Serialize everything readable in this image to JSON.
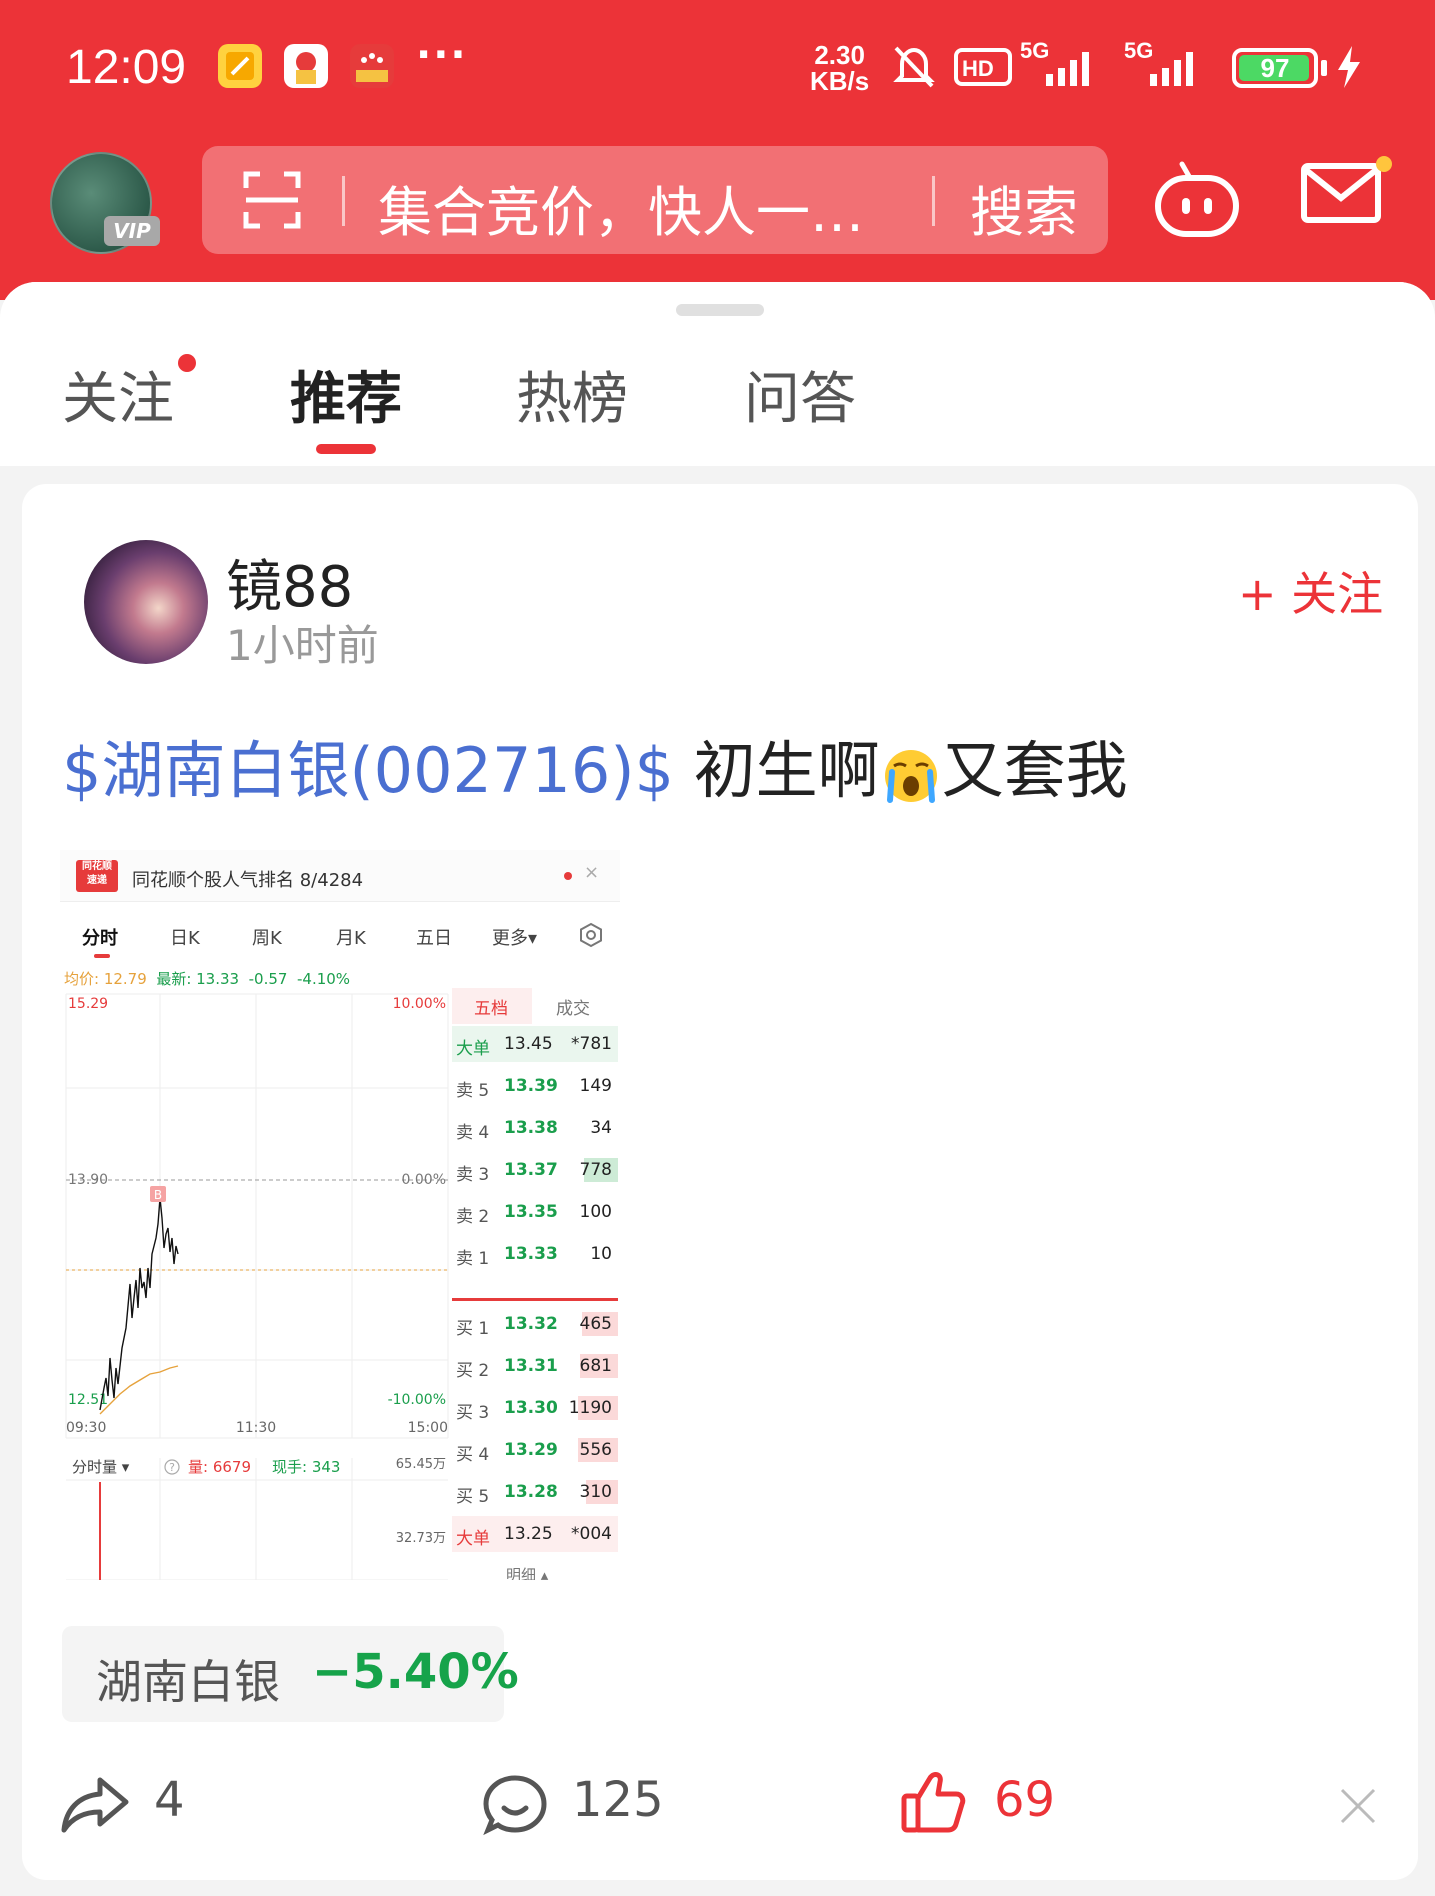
{
  "status_bar": {
    "time": "12:09",
    "net_speed_value": "2.30",
    "net_speed_unit": "KB/s",
    "signal_1": "5G",
    "signal_2": "5G",
    "battery": "97",
    "battery_level_percent": 97
  },
  "header": {
    "search_placeholder": "集合竞价，快人一…",
    "search_button": "搜索",
    "vip_badge": "VIP"
  },
  "tabs": [
    {
      "label": "关注",
      "has_dot": true
    },
    {
      "label": "推荐",
      "active": true
    },
    {
      "label": "热榜"
    },
    {
      "label": "问答"
    }
  ],
  "post": {
    "author": "镜88",
    "time": "1小时前",
    "follow": "+ 关注",
    "stock_link": "$湖南白银(002716)$",
    "text_part1": " 初生啊",
    "text_part2": "又套我",
    "emoji": "crying-face"
  },
  "screenshot": {
    "app_logo": "同花顺速递",
    "title": "同花顺个股人气排名 8/4284",
    "tabs": [
      "分时",
      "日K",
      "周K",
      "月K",
      "五日",
      "更多▾"
    ],
    "info_avg": "均价: 12.79",
    "info_latest": "最新: 13.33",
    "info_change": "-0.57",
    "info_pct": "-4.10%",
    "y_top": "15.29",
    "y_mid": "13.90",
    "y_bot": "12.51",
    "pct_top": "10.00%",
    "pct_mid": "0.00%",
    "pct_bot": "-10.00%",
    "x_start": "09:30",
    "x_mid": "11:30",
    "x_end": "15:00",
    "vol_label": "分时量 ▾",
    "vol_amount": "量: 6679",
    "vol_hand": "现手: 343",
    "vol_top": "65.45万",
    "vol_mid": "32.73万",
    "marker": "B",
    "orderbook_tab_1": "五档",
    "orderbook_tab_2": "成交",
    "orderbook_footer": "明细 ▴",
    "orderbook": [
      {
        "label": "大单",
        "price": "13.45",
        "vol": "*781"
      },
      {
        "label": "卖 5",
        "price": "13.39",
        "vol": "149"
      },
      {
        "label": "卖 4",
        "price": "13.38",
        "vol": "34"
      },
      {
        "label": "卖 3",
        "price": "13.37",
        "vol": "778"
      },
      {
        "label": "卖 2",
        "price": "13.35",
        "vol": "100"
      },
      {
        "label": "卖 1",
        "price": "13.33",
        "vol": "10"
      },
      {
        "label": "买 1",
        "price": "13.32",
        "vol": "465"
      },
      {
        "label": "买 2",
        "price": "13.31",
        "vol": "681"
      },
      {
        "label": "买 3",
        "price": "13.30",
        "vol": "1190"
      },
      {
        "label": "买 4",
        "price": "13.29",
        "vol": "556"
      },
      {
        "label": "买 5",
        "price": "13.28",
        "vol": "310"
      },
      {
        "label": "大单",
        "price": "13.25",
        "vol": "*004"
      }
    ]
  },
  "stock_chip": {
    "name": "湖南白银",
    "change": "−5.40%"
  },
  "actions": {
    "share_count": "4",
    "comment_count": "125",
    "like_count": "69"
  },
  "colors": {
    "brand_red": "#ec3338",
    "link_blue": "#4a6fd1",
    "down_green": "#16a34a"
  }
}
